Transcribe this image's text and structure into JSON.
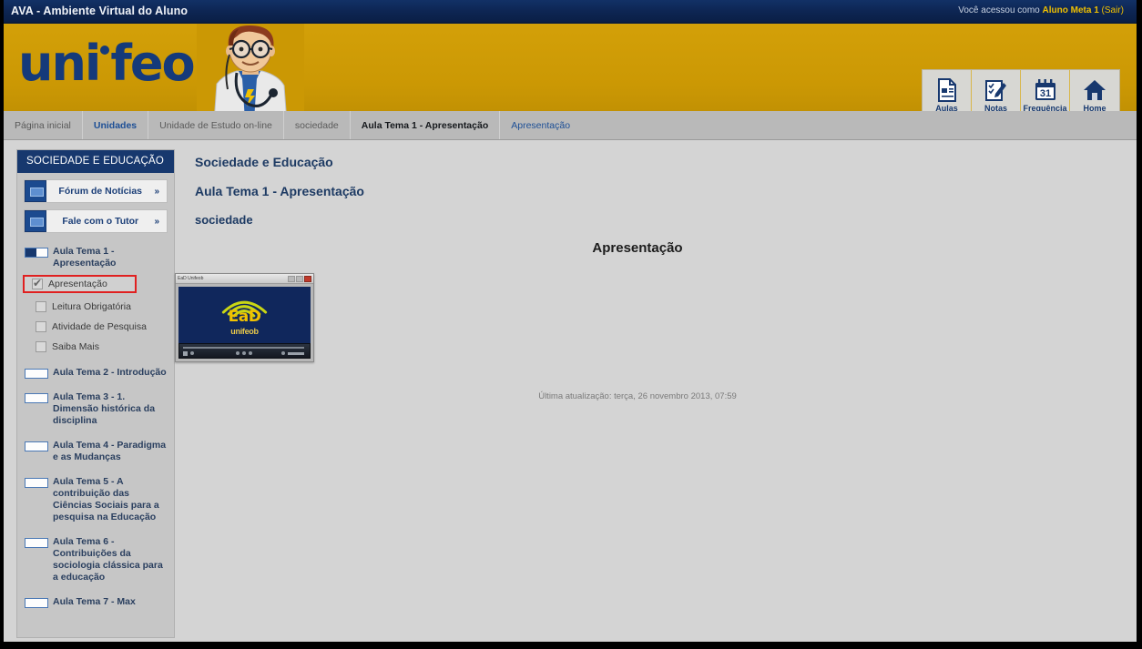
{
  "topbar": {
    "title": "AVA - Ambiente Virtual do Aluno",
    "access_prefix": "Você acessou como ",
    "user_name": "Aluno Meta 1",
    "logout": "(Sair)"
  },
  "banner": {
    "logo_text_1": "uni",
    "logo_text_2": "feob",
    "icons": [
      {
        "name": "aulas-icon",
        "label": "Aulas"
      },
      {
        "name": "notas-icon",
        "label": "Notas"
      },
      {
        "name": "frequencia-icon",
        "label": "Frequência",
        "day": "31"
      },
      {
        "name": "home-icon",
        "label": "Home"
      }
    ]
  },
  "breadcrumb": [
    {
      "label": "Página inicial",
      "style": "plain"
    },
    {
      "label": "Unidades",
      "style": "link"
    },
    {
      "label": "Unidade de Estudo on-line",
      "style": "plain"
    },
    {
      "label": "sociedade",
      "style": "plain"
    },
    {
      "label": "Aula Tema 1 - Apresentação",
      "style": "current"
    },
    {
      "label": "Apresentação",
      "style": "tail"
    }
  ],
  "sidebar": {
    "header": "SOCIEDADE E EDUCAÇÃO",
    "buttons": [
      {
        "label": "Fórum de Notícias",
        "chevron": "»"
      },
      {
        "label": "Fale com o Tutor",
        "chevron": "»"
      }
    ],
    "topics": [
      {
        "label": "Aula Tema 1 - Apresentação",
        "progress": 50
      },
      {
        "label": "Aula Tema 2 - Introdução",
        "progress": 0
      },
      {
        "label": "Aula Tema 3 - 1. Dimensão histórica da disciplina",
        "progress": 0
      },
      {
        "label": "Aula Tema 4 - Paradigma e as Mudanças",
        "progress": 0
      },
      {
        "label": "Aula Tema 5 - A contribuição das Ciências Sociais para a pesquisa na Educação",
        "progress": 0
      },
      {
        "label": "Aula Tema 6 - Contribuições da sociologia clássica para a educação",
        "progress": 0
      },
      {
        "label": "Aula Tema 7 - Max",
        "progress": 0
      }
    ],
    "subitems": [
      {
        "label": "Apresentação",
        "checked": true,
        "active": true
      },
      {
        "label": "Leitura Obrigatória",
        "checked": false,
        "active": false
      },
      {
        "label": "Atividade de Pesquisa",
        "checked": false,
        "active": false
      },
      {
        "label": "Saiba Mais",
        "checked": false,
        "active": false
      }
    ]
  },
  "content": {
    "heading_course": "Sociedade e Educação",
    "heading_topic": "Aula Tema 1 - Apresentação",
    "heading_unit": "sociedade",
    "section_title": "Apresentação",
    "updated": "Última atualização: terça, 26 novembro 2013, 07:59",
    "player": {
      "window_title": "EaD Unifeob",
      "logo_main": "EaD",
      "logo_sub": "unifeob"
    }
  },
  "colors": {
    "navy": "#17386e",
    "gold": "#cc9a06",
    "accent_yellow": "#f0c000",
    "highlight_red": "#e02020",
    "link_blue": "#1d4f96"
  }
}
